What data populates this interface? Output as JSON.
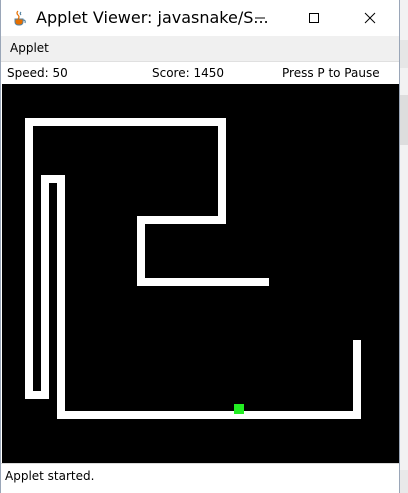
{
  "window": {
    "title": "Applet Viewer: javasnake/S...",
    "icon": "java-cup-icon",
    "controls": [
      "minimize-icon",
      "maximize-icon",
      "close-icon"
    ]
  },
  "menu": {
    "items": [
      {
        "label": "Applet"
      }
    ]
  },
  "game": {
    "speed_text": "Speed: 50",
    "score_text": "Score: 1450",
    "pause_hint": "Press P to Pause",
    "board_color": "#000000",
    "snake_color": "#ffffff",
    "food_color": "#22ee22"
  },
  "applet_status": "Applet started."
}
